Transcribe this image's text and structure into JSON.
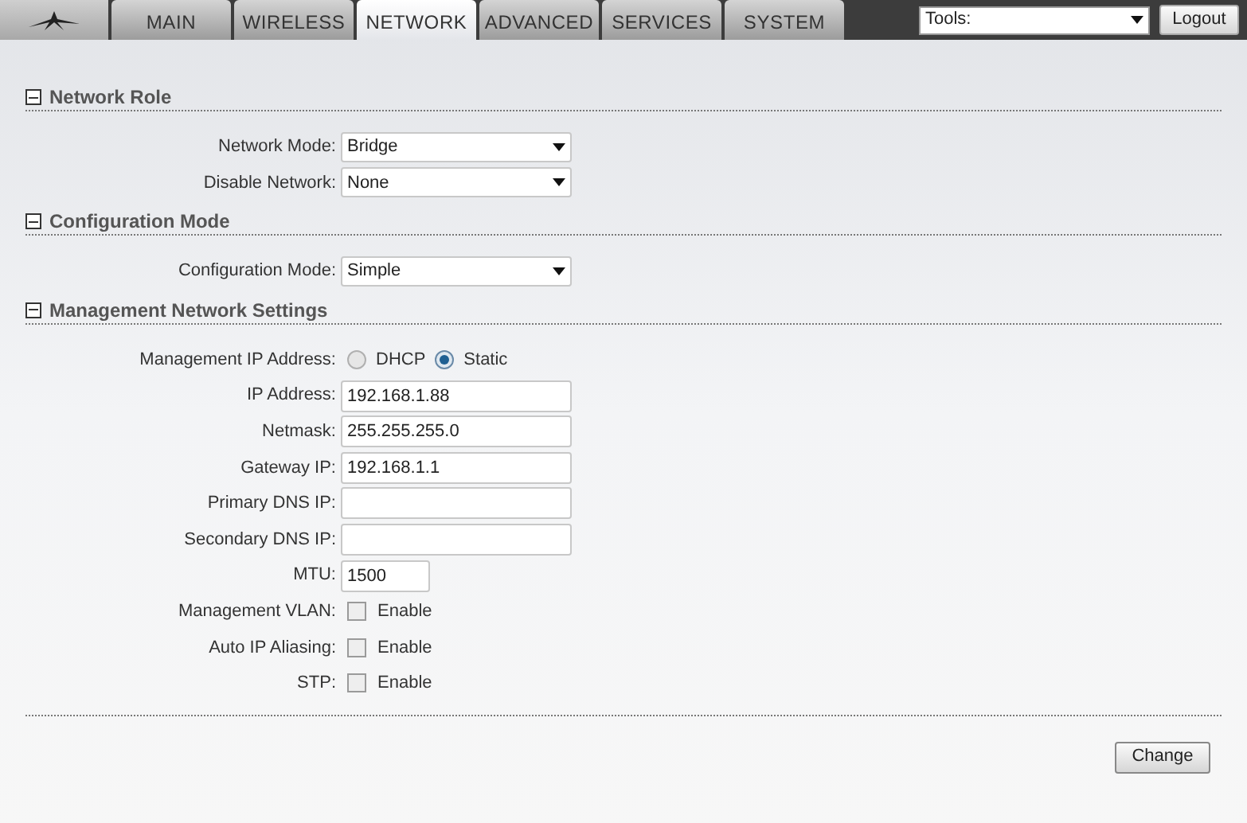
{
  "tabs": [
    {
      "label": "MAIN",
      "selected": false
    },
    {
      "label": "WIRELESS",
      "selected": false
    },
    {
      "label": "NETWORK",
      "selected": true
    },
    {
      "label": "ADVANCED",
      "selected": false
    },
    {
      "label": "SERVICES",
      "selected": false
    },
    {
      "label": "SYSTEM",
      "selected": false
    }
  ],
  "tools": {
    "value": "Tools:"
  },
  "logout": "Logout",
  "sections": [
    {
      "title": "Network Role",
      "expanded": true,
      "rows": [
        {
          "kind": "select",
          "label": "Network Mode:",
          "value": "Bridge"
        },
        {
          "kind": "select",
          "label": "Disable Network:",
          "value": "None"
        }
      ]
    },
    {
      "title": "Configuration Mode",
      "expanded": true,
      "rows": [
        {
          "kind": "select",
          "label": "Configuration Mode:",
          "value": "Simple"
        }
      ]
    },
    {
      "title": "Management Network Settings",
      "expanded": true,
      "rows": [
        {
          "kind": "radio",
          "label": "Management IP Address:",
          "options": [
            {
              "label": "DHCP",
              "selected": false
            },
            {
              "label": "Static",
              "selected": true
            }
          ]
        },
        {
          "kind": "text",
          "label": "IP Address:",
          "value": "192.168.1.88"
        },
        {
          "kind": "text",
          "label": "Netmask:",
          "value": "255.255.255.0"
        },
        {
          "kind": "text",
          "label": "Gateway IP:",
          "value": "192.168.1.1"
        },
        {
          "kind": "text",
          "label": "Primary DNS IP:"
        },
        {
          "kind": "text",
          "label": "Secondary DNS IP:"
        },
        {
          "kind": "short",
          "label": "MTU:",
          "value": "1500"
        },
        {
          "kind": "checkbox",
          "label": "Management VLAN:",
          "text": "Enable",
          "checked": false
        },
        {
          "kind": "checkbox",
          "label": "Auto IP Aliasing:",
          "text": "Enable",
          "checked": false
        },
        {
          "kind": "checkbox",
          "label": "STP:",
          "text": "Enable",
          "checked": false
        }
      ]
    }
  ],
  "change": "Change"
}
